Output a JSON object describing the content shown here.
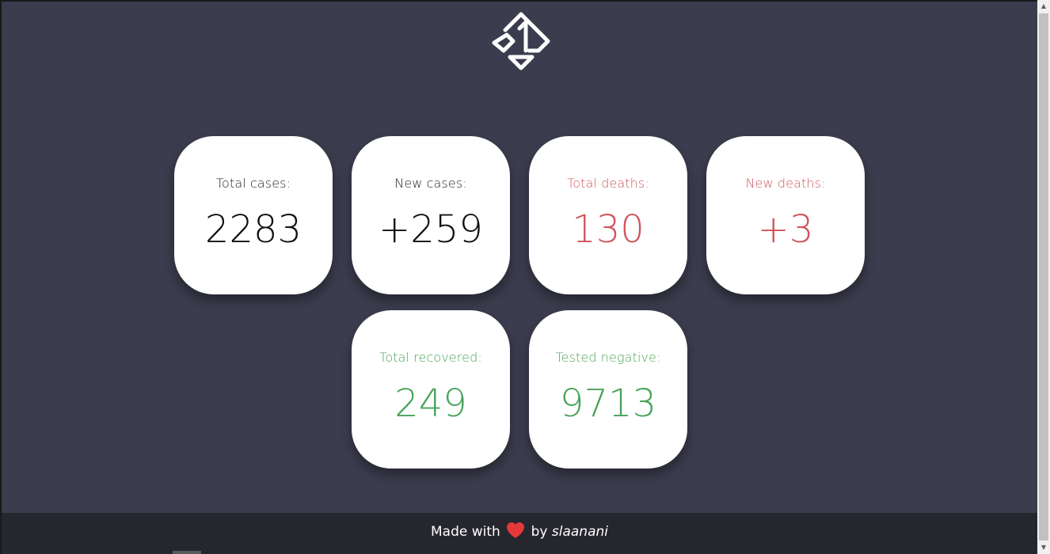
{
  "logo": {
    "icon": "brand-diamond-logo-icon"
  },
  "stats": {
    "total_cases": {
      "label": "Total cases:",
      "value": "2283"
    },
    "new_cases": {
      "label": "New cases:",
      "value": "+259"
    },
    "total_deaths": {
      "label": "Total deaths:",
      "value": "130"
    },
    "new_deaths": {
      "label": "New deaths:",
      "value": "+3"
    },
    "total_recovered": {
      "label": "Total recovered:",
      "value": "249"
    },
    "tested_negative": {
      "label": "Tested negative:",
      "value": "9713"
    }
  },
  "footer": {
    "made_with": "Made with",
    "heart_icon": "heart-icon",
    "by": "by",
    "author": "slaanani"
  },
  "colors": {
    "background": "#3b3c4d",
    "card": "#ffffff",
    "neutral": "#111111",
    "deaths": "#d0545a",
    "recovered": "#48a35a",
    "footer": "#26262f",
    "heart": "#e5383b"
  }
}
